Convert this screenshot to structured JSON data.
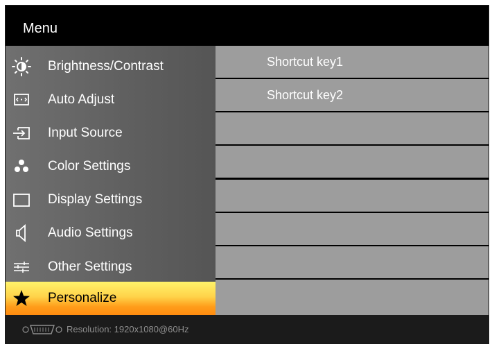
{
  "title": "Menu",
  "menu_items": [
    {
      "label": "Brightness/Contrast",
      "icon": "brightness-icon"
    },
    {
      "label": "Auto Adjust",
      "icon": "auto-adjust-icon"
    },
    {
      "label": "Input Source",
      "icon": "input-source-icon"
    },
    {
      "label": "Color Settings",
      "icon": "color-settings-icon"
    },
    {
      "label": "Display Settings",
      "icon": "display-settings-icon"
    },
    {
      "label": "Audio Settings",
      "icon": "speaker-icon"
    },
    {
      "label": "Other Settings",
      "icon": "sliders-icon"
    },
    {
      "label": "Personalize",
      "icon": "star-icon",
      "selected": true
    }
  ],
  "submenu": [
    {
      "label": "Shortcut key1"
    },
    {
      "label": "Shortcut key2"
    },
    {
      "label": ""
    },
    {
      "label": ""
    },
    {
      "label": ""
    },
    {
      "label": ""
    },
    {
      "label": ""
    },
    {
      "label": ""
    }
  ],
  "status": {
    "resolution": "Resolution:  1920x1080@60Hz",
    "icon": "vga-connector-icon"
  },
  "colors": {
    "highlight_top": "#fff36a",
    "highlight_bottom": "#ff8c10",
    "submenu_bg": "#9d9d9d",
    "status_text": "#8f8f8f"
  }
}
